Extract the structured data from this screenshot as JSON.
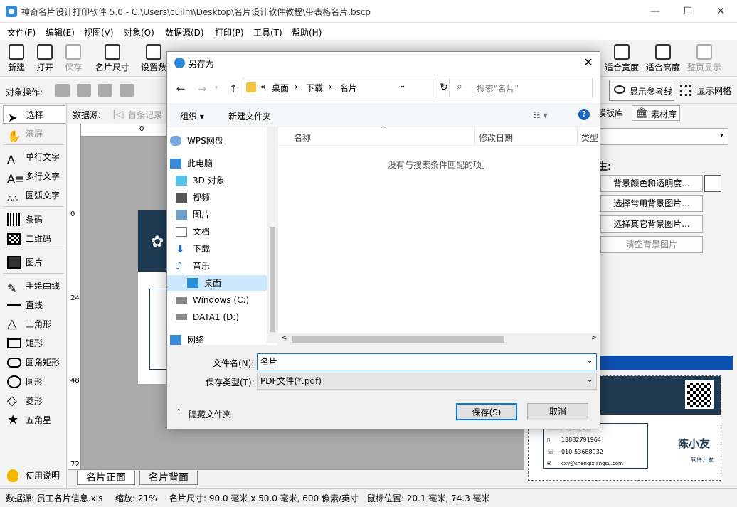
{
  "window": {
    "title": "神奇名片设计打印软件 5.0 - C:\\Users\\cuilm\\Desktop\\名片设计软件教程\\带表格名片.bscp",
    "minimize": "—",
    "maximize": "☐",
    "close": "✕"
  },
  "menu": [
    "文件(F)",
    "编辑(E)",
    "视图(V)",
    "对象(O)",
    "数据源(D)",
    "打印(P)",
    "工具(T)",
    "帮助(H)"
  ],
  "toolbar": {
    "new": "新建",
    "open": "打开",
    "save": "保存",
    "card_size": "名片尺寸",
    "page_setup": "设置数",
    "fit_width": "适合宽度",
    "fit_height": "适合高度",
    "fit_page": "整页显示"
  },
  "toolbar2": {
    "object_ops": "对象操作:",
    "show_guides": "显示参考线",
    "show_grid": "显示网格"
  },
  "datasource_bar": {
    "label": "数据源:",
    "first": "首条记录"
  },
  "tools": [
    "选择",
    "滚屏",
    "单行文字",
    "多行文字",
    "圆弧文字",
    "条码",
    "二维码",
    "图片",
    "手绘曲线",
    "直线",
    "三角形",
    "矩形",
    "圆角矩形",
    "圆形",
    "菱形",
    "五角星",
    "使用说明"
  ],
  "rulers": {
    "top0": "0",
    "left0": "0",
    "left24": "24",
    "left48": "48",
    "left72": "72"
  },
  "right_panel": {
    "tab_templates": "模板库",
    "tab_materials": "素材库",
    "label": "生:",
    "btn_bg_color": "背景颜色和透明度...",
    "btn_common_bg": "选择常用背景图片...",
    "btn_other_bg": "选择其它背景图片...",
    "btn_clear_bg": "清空背景图片"
  },
  "preview": {
    "name": "陈小友",
    "title": "软件开发",
    "address": "xxxx广场D座6层",
    "phone": "13882791964",
    "tel": "010-53688932",
    "email": "cxy@shenqixiangsu.com"
  },
  "canvas_tabs": {
    "front": "名片正面",
    "back": "名片背面"
  },
  "status": {
    "datasource": "数据源: 员工名片信息.xls",
    "zoom": "缩放: 21%",
    "card_size": "名片尺寸: 90.0 毫米 x 50.0 毫米, 600 像素/英寸",
    "mouse": "鼠标位置: 20.1 毫米, 74.3 毫米"
  },
  "dialog": {
    "title": "另存为",
    "close": "✕",
    "breadcrumb": [
      "«",
      "桌面",
      "›",
      "下载",
      "›",
      "名片"
    ],
    "search_placeholder": "搜索\"名片\"",
    "organize": "组织 ▾",
    "new_folder": "新建文件夹",
    "nav_items": [
      "WPS网盘",
      "此电脑",
      "3D 对象",
      "视频",
      "图片",
      "文档",
      "下载",
      "音乐",
      "桌面",
      "Windows (C:)",
      "DATA1 (D:)",
      "网络"
    ],
    "columns": {
      "name": "名称",
      "date": "修改日期",
      "type": "类型"
    },
    "empty": "没有与搜索条件匹配的项。",
    "filename_label": "文件名(N):",
    "filename": "名片",
    "filetype_label": "保存类型(T):",
    "filetype": "PDF文件(*.pdf)",
    "hide_folders": "隐藏文件夹",
    "save": "保存(S)",
    "cancel": "取消"
  },
  "colors": {
    "accent": "#0078d7",
    "card_dark": "#1e3a52",
    "selected_nav": "#cce8ff"
  }
}
